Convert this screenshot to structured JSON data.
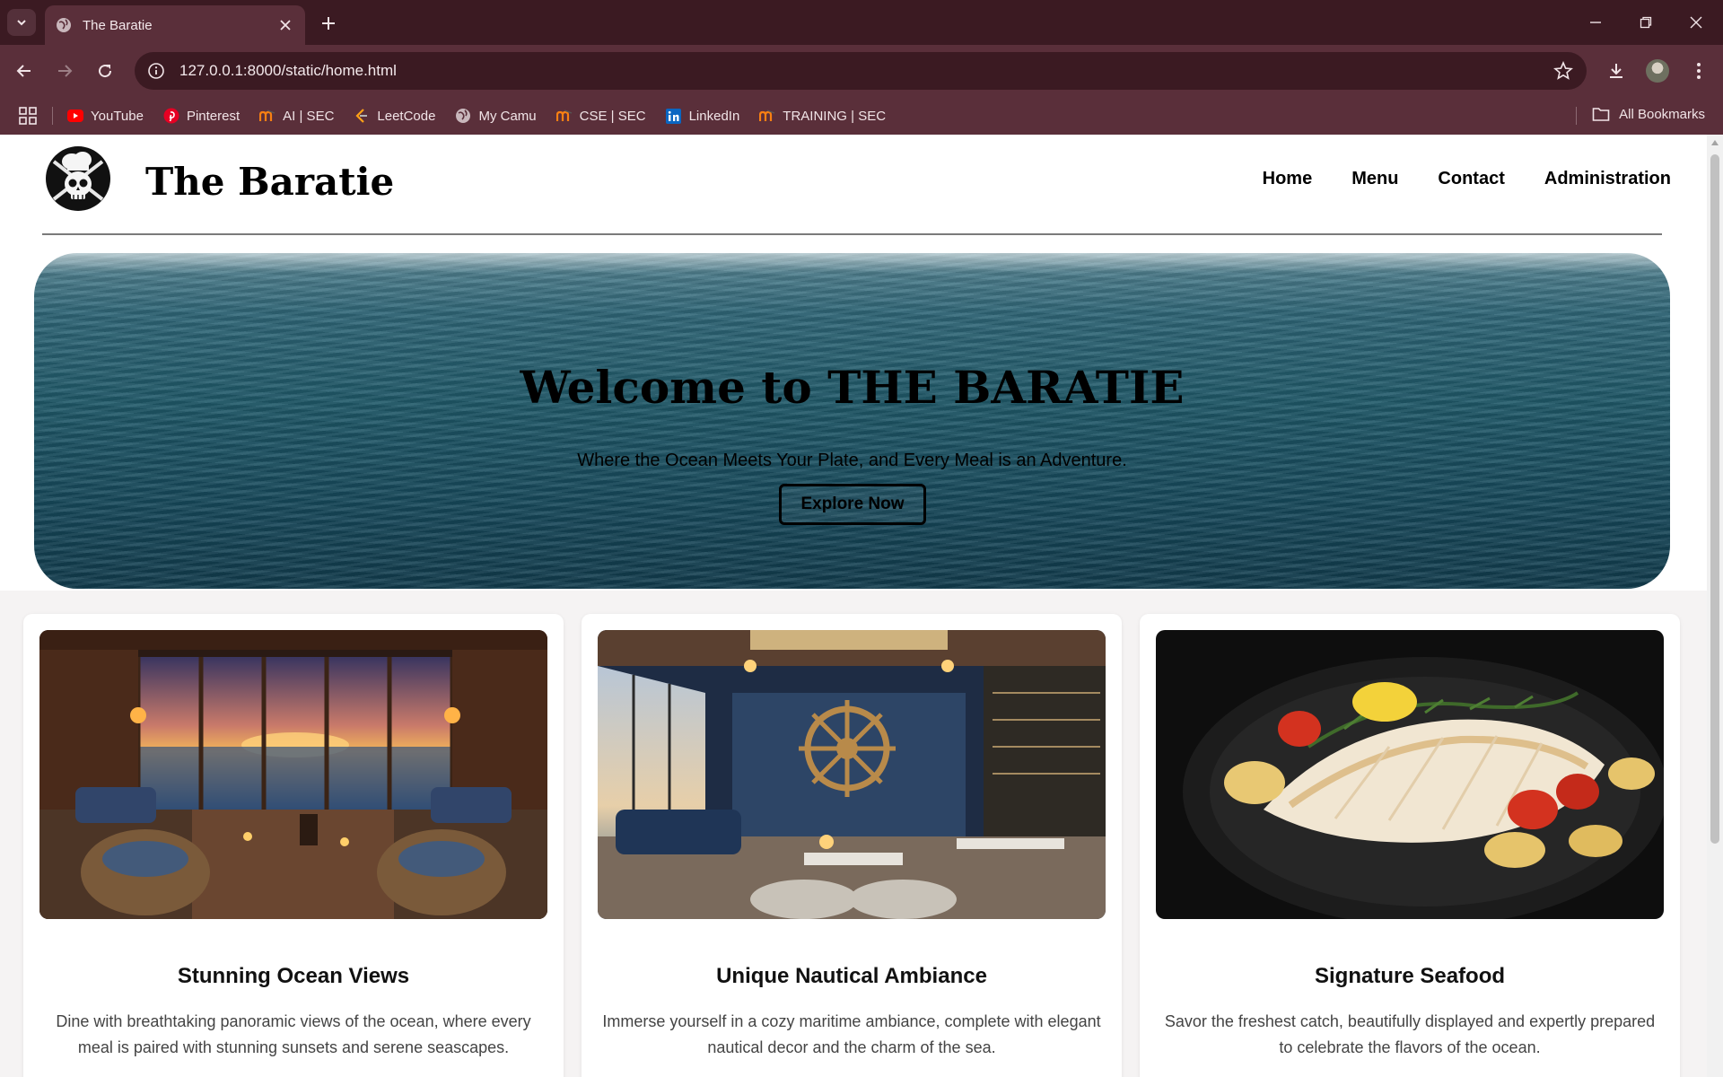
{
  "browser": {
    "tab_title": "The Baratie",
    "url": "127.0.0.1:8000/static/home.html",
    "bookmarks": [
      {
        "label": "YouTube",
        "icon": "youtube-icon",
        "color": "#ff0000"
      },
      {
        "label": "Pinterest",
        "icon": "pinterest-icon",
        "color": "#e60023"
      },
      {
        "label": "AI | SEC",
        "icon": "moodle-icon",
        "color": "#f98012"
      },
      {
        "label": "LeetCode",
        "icon": "leetcode-icon",
        "color": "#ffa116"
      },
      {
        "label": "My Camu",
        "icon": "globe-icon",
        "color": "#c9b7bc"
      },
      {
        "label": "CSE | SEC",
        "icon": "moodle-icon",
        "color": "#f98012"
      },
      {
        "label": "LinkedIn",
        "icon": "linkedin-icon",
        "color": "#0a66c2"
      },
      {
        "label": "TRAINING | SEC",
        "icon": "moodle-icon",
        "color": "#f98012"
      }
    ],
    "all_bookmarks_label": "All Bookmarks"
  },
  "site": {
    "brand": "The Baratie",
    "nav": [
      "Home",
      "Menu",
      "Contact",
      "Administration"
    ]
  },
  "hero": {
    "title": "Welcome to THE BARATIE",
    "subtitle": "Where the Ocean Meets Your Plate, and Every Meal is an Adventure.",
    "button_label": "Explore Now"
  },
  "features": [
    {
      "title": "Stunning Ocean Views",
      "description": "Dine with breathtaking panoramic views of the ocean, where every meal is paired with stunning sunsets and serene seascapes."
    },
    {
      "title": "Unique Nautical Ambiance",
      "description": "Immerse yourself in a cozy maritime ambiance, complete with elegant nautical decor and the charm of the sea."
    },
    {
      "title": "Signature Seafood",
      "description": "Savor the freshest catch, beautifully displayed and expertly prepared to celebrate the flavors of the ocean."
    }
  ],
  "colors": {
    "chrome_dark": "#3b1a22",
    "chrome_mid": "#5a2f3a",
    "ocean": "#1f5868"
  }
}
